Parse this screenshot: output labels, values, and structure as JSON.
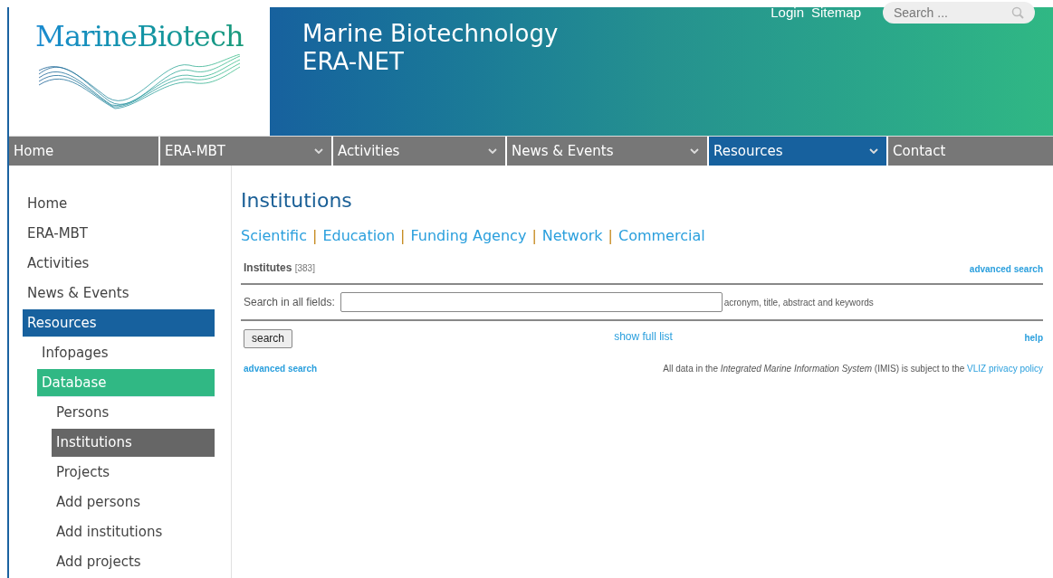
{
  "header": {
    "logo_text": "MarineBiotech",
    "title_lines": [
      "Marine Biotechnology",
      "ERA-NET"
    ],
    "top_links": [
      "Login",
      "Sitemap"
    ],
    "search": {
      "placeholder": "Search ..."
    }
  },
  "nav": [
    {
      "label": "Home",
      "has_menu": false,
      "selected": false
    },
    {
      "label": "ERA-MBT",
      "has_menu": true,
      "selected": false
    },
    {
      "label": "Activities",
      "has_menu": true,
      "selected": false
    },
    {
      "label": "News & Events",
      "has_menu": true,
      "selected": false
    },
    {
      "label": "Resources",
      "has_menu": true,
      "selected": true
    },
    {
      "label": "Contact",
      "has_menu": false,
      "selected": false
    }
  ],
  "sidebar": {
    "items": [
      {
        "label": "Home",
        "expanded": false,
        "selected": false
      },
      {
        "label": "ERA-MBT",
        "expanded": false,
        "selected": false
      },
      {
        "label": "Activities",
        "expanded": false,
        "selected": false
      },
      {
        "label": "News & Events",
        "expanded": false,
        "selected": false
      },
      {
        "label": "Resources",
        "expanded": true,
        "selected": false,
        "children": [
          {
            "label": "Infopages",
            "expanded": false,
            "selected": false
          },
          {
            "label": "Database",
            "expanded": true,
            "selected": false,
            "children": [
              {
                "label": "Persons",
                "expanded": false,
                "selected": false
              },
              {
                "label": "Institutions",
                "expanded": false,
                "selected": true
              },
              {
                "label": "Projects",
                "expanded": false,
                "selected": false
              },
              {
                "label": "Add persons",
                "expanded": false,
                "selected": false
              },
              {
                "label": "Add institutions",
                "expanded": false,
                "selected": false
              },
              {
                "label": "Add projects",
                "expanded": false,
                "selected": false
              }
            ]
          }
        ]
      }
    ]
  },
  "main": {
    "title": "Institutions",
    "type_links": [
      "Scientific",
      "Education",
      "Funding Agency",
      "Network",
      "Commercial"
    ],
    "type_separator": "|",
    "list_label": "Institutes",
    "count": "[383]",
    "advanced_search_top": "advanced search",
    "search_label": "Search in all fields:",
    "search_hint": "acronym, title, abstract and keywords",
    "search_button": "search",
    "show_full_list": "show full list",
    "help": "help",
    "advanced_search_bottom": "advanced search",
    "disclaimer": "All data in the *Integrated Marine Information System* (IMIS) is subject to the",
    "privacy_link": "VLIZ privacy policy"
  }
}
